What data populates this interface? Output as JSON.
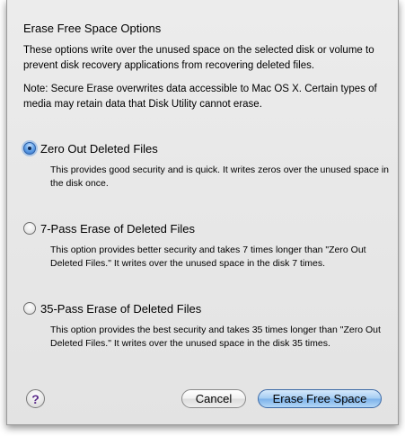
{
  "dialog": {
    "title": "Erase Free Space Options",
    "description": "These options write over the unused space on the selected disk or volume to prevent disk recovery applications from recovering deleted files.",
    "note": "Note: Secure Erase overwrites data accessible to Mac OS X.  Certain types of media may retain data that Disk Utility cannot erase."
  },
  "options": [
    {
      "label": "Zero Out Deleted Files",
      "description": "This provides good security and is quick. It writes zeros over the unused space in the disk once.",
      "selected": true
    },
    {
      "label": "7-Pass Erase of Deleted Files",
      "description": "This option provides better security and takes 7 times longer than \"Zero Out Deleted Files.\" It writes over the unused space in the disk 7 times.",
      "selected": false
    },
    {
      "label": "35-Pass Erase of Deleted Files",
      "description": "This option provides the best security and takes 35 times longer than \"Zero Out Deleted Files.\" It writes over the unused space in the disk 35 times.",
      "selected": false
    }
  ],
  "buttons": {
    "help": "?",
    "cancel": "Cancel",
    "erase": "Erase Free Space"
  },
  "icons": {
    "help": "help-icon"
  },
  "colors": {
    "primary_button": "#8fc0ef",
    "selected_radio": "#3a7bd5"
  }
}
